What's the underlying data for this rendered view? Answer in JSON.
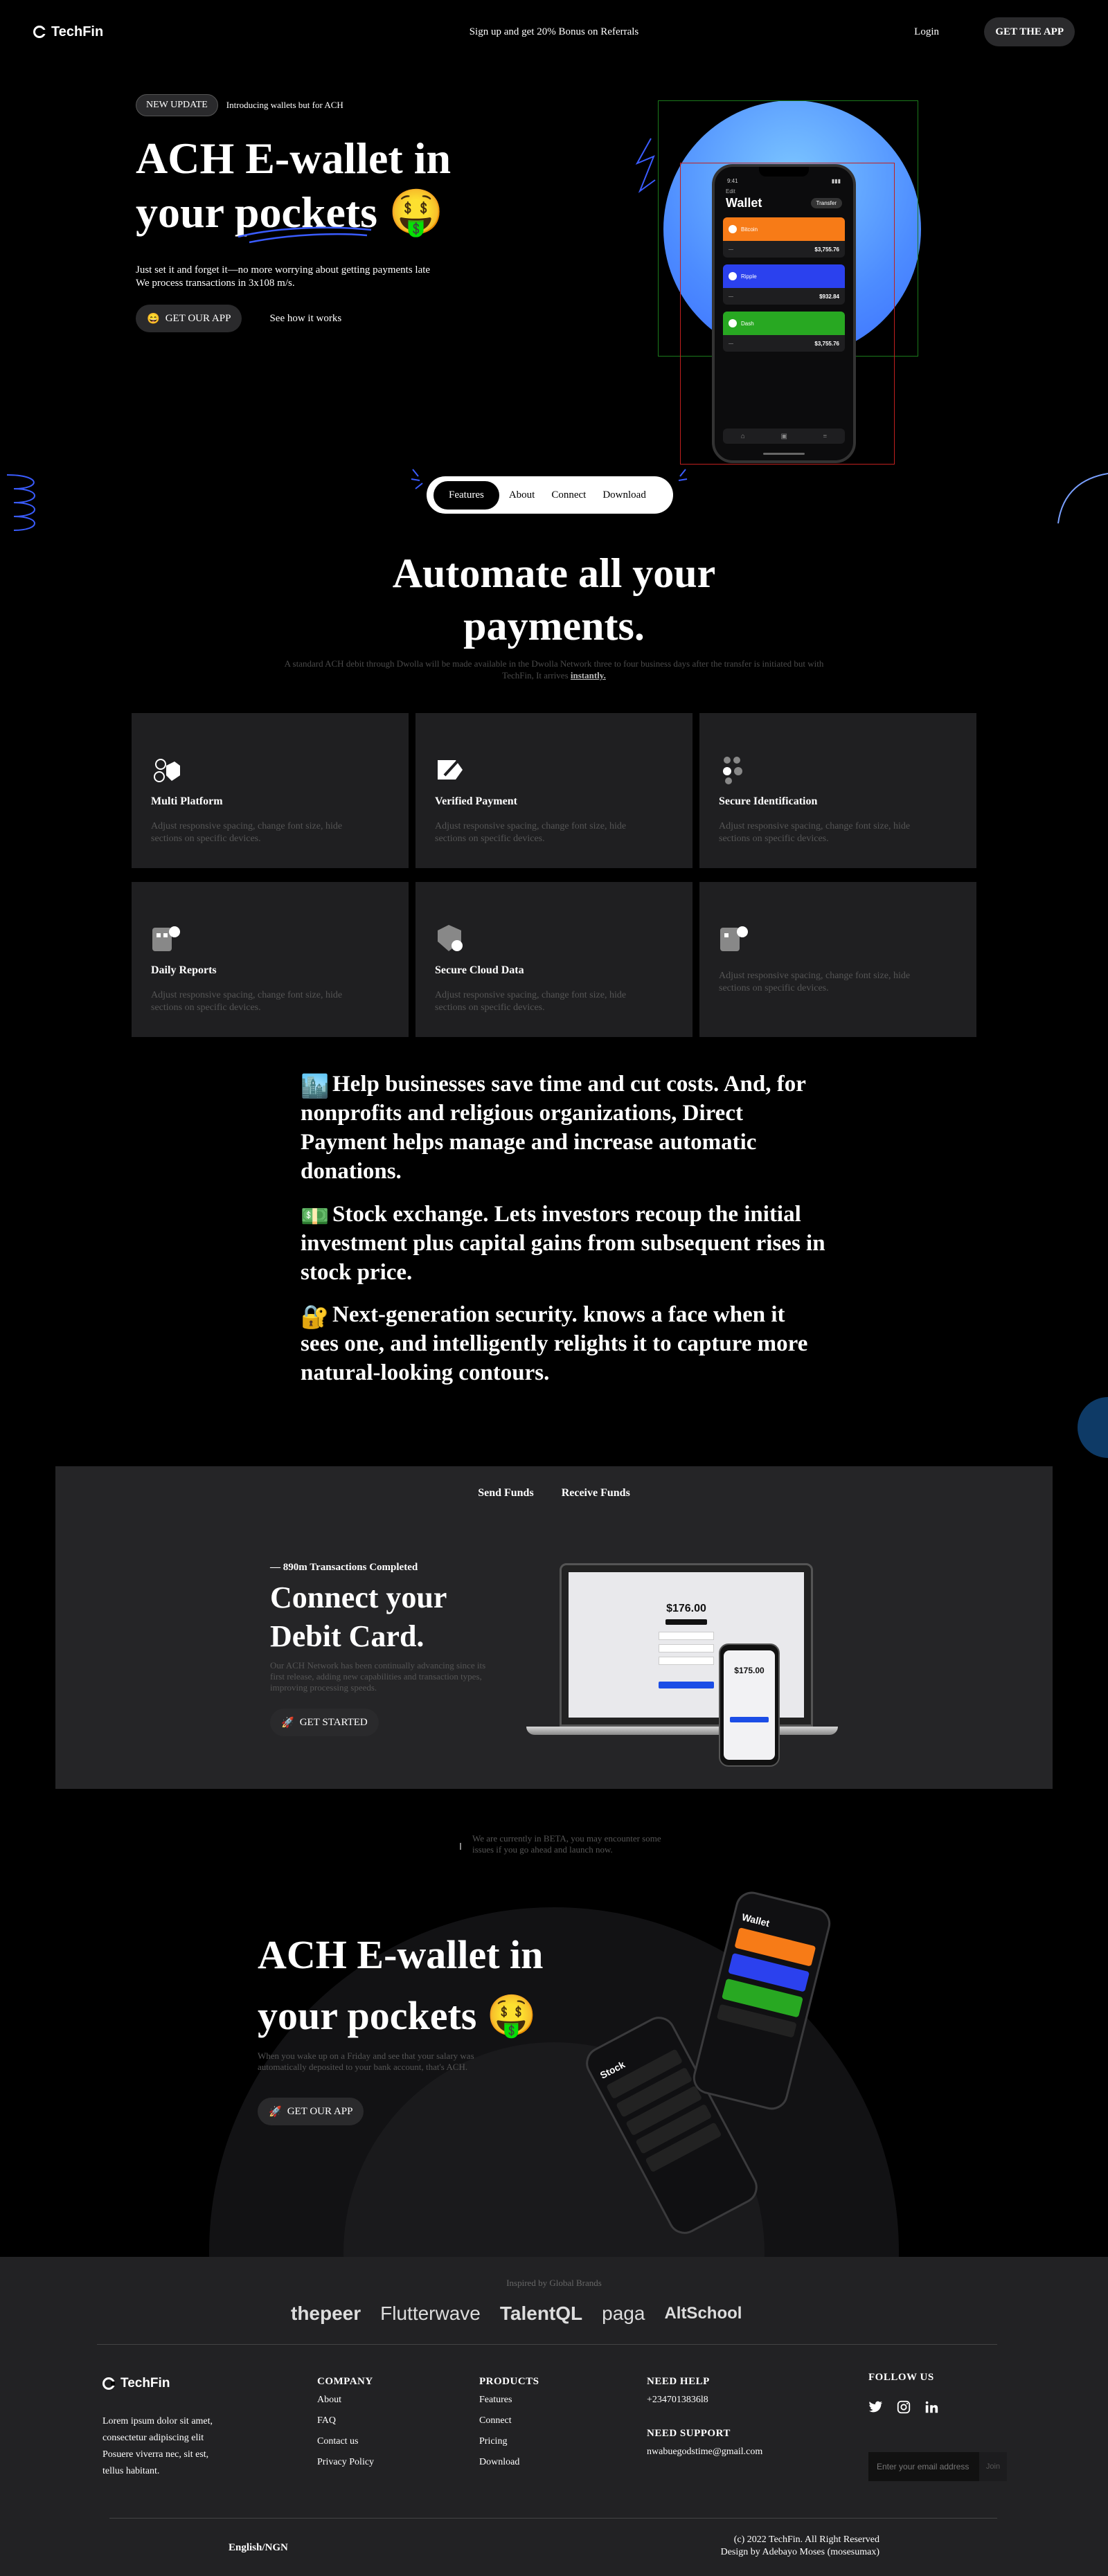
{
  "nav": {
    "brand": "TechFin",
    "promo": "Sign up and get 20% Bonus on Referrals",
    "login": "Login",
    "cta": "GET THE APP"
  },
  "hero": {
    "badge": "NEW UPDATE",
    "badge_text": "Introducing wallets but for ACH",
    "title_line1": "ACH E-wallet in",
    "title_line2": "your pockets",
    "title_emoji": "🤑",
    "subtitle_line1": "Just set it and forget it—no more worrying about getting payments late",
    "subtitle_line2": "We process transactions in 3x108 m/s.",
    "primary_cta": "GET OUR APP",
    "primary_cta_icon": "😄",
    "secondary_cta": "See how it works",
    "accent_blue": "#4d8cff"
  },
  "phone": {
    "time": "9:41",
    "back": "Edit",
    "title": "Wallet",
    "tag": "Transfer",
    "cards": [
      {
        "name": "Bitcoin",
        "value": "$3,755.76",
        "color": "#f77b17"
      },
      {
        "name": "Ripple",
        "value": "$932.84",
        "color": "#2b41ee"
      },
      {
        "name": "Dash",
        "value": "$3,755.76",
        "color": "#28a822"
      }
    ]
  },
  "tabs": {
    "items": [
      "Features",
      "About",
      "Connect",
      "Download"
    ],
    "active": "Features"
  },
  "automate": {
    "title_line1": "Automate all your",
    "title_line2": "payments.",
    "subtitle": "A standard ACH debit through Dwolla will be made available in the Dwolla Network three to four business days after the transfer is initiated but with TechFin, It arrives",
    "subtitle_emphasis": "instantly."
  },
  "features": [
    {
      "title": "Multi Platform",
      "desc": "Adjust responsive spacing, change font size, hide sections on specific devices.",
      "icon": "cube-icon"
    },
    {
      "title": "Verified Payment",
      "desc": "Adjust responsive spacing, change font size, hide sections on specific devices.",
      "icon": "verified-icon"
    },
    {
      "title": "Secure Identification",
      "desc": "Adjust responsive spacing, change font size, hide sections on specific devices.",
      "icon": "people-icon"
    },
    {
      "title": "Daily Reports",
      "desc": "Adjust responsive spacing, change font size, hide sections on specific devices.",
      "icon": "report-icon"
    },
    {
      "title": "Secure Cloud Data",
      "desc": "Adjust responsive spacing, change font size, hide sections on specific devices.",
      "icon": "cloud-shield-icon"
    },
    {
      "title": "",
      "desc": "Adjust responsive spacing, change font size, hide sections on specific devices.",
      "icon": "report-icon"
    }
  ],
  "statements": [
    {
      "emoji": "🏙️",
      "text": "Help businesses save time and cut costs. And, for nonprofits and religious organizations, Direct Payment helps manage and increase automatic donations."
    },
    {
      "emoji": "💵",
      "text": "Stock exchange. Lets investors recoup the initial investment plus capital gains from subsequent rises in stock price."
    },
    {
      "emoji": "🔐",
      "text": "Next-generation security. knows a face when it sees one, and intelligently relights it to capture more natural-looking contours."
    }
  ],
  "connect": {
    "tabs": [
      "Send Funds",
      "Receive Funds"
    ],
    "eyebrow": "— 890m Transactions Completed",
    "title_line1": "Connect your",
    "title_line2": "Debit Card.",
    "subtitle": "Our ACH Network has been continually advancing since its first release, adding new capabilities and transaction types, improving processing speeds.",
    "cta": "GET STARTED",
    "cta_icon": "🚀",
    "laptop_amount": "$176.00",
    "phone_amount": "$175.00"
  },
  "beta": {
    "text": "We are currently in BETA, you may encounter some issues if you go ahead and launch now."
  },
  "bottom_hero": {
    "title_line1": "ACH E-wallet in",
    "title_line2": "your pockets",
    "title_emoji": "🤑",
    "subtitle": "When you wake up on a Friday and see that your salary was automatically deposited to your bank account, that's ACH.",
    "cta": "GET OUR APP",
    "cta_icon": "🚀",
    "phone1_title": "Stock",
    "phone2_title": "Wallet"
  },
  "footer": {
    "inspired": "Inspired by Global Brands",
    "brands": [
      "thepeer",
      "Flutterwave",
      "TalentQL",
      "paga",
      "AltSchool"
    ],
    "brand_name": "TechFin",
    "about": "Lorem ipsum dolor sit amet, consectetur adipiscing elit Posuere viverra nec, sit est, tellus habitant.",
    "company": {
      "title": "COMPANY",
      "items": [
        "About",
        "FAQ",
        "Contact us",
        "Privacy Policy"
      ]
    },
    "products": {
      "title": "PRODUCTS",
      "items": [
        "Features",
        "Connect",
        "Pricing",
        "Download"
      ]
    },
    "help": {
      "title": "NEED HELP",
      "phone": "+2347013836l8"
    },
    "support": {
      "title": "NEED SUPPORT",
      "email": "nwabuegodstime@gmail.com"
    },
    "follow": {
      "title": "FOLLOW US",
      "icons": [
        "twitter-icon",
        "instagram-icon",
        "linkedin-icon"
      ]
    },
    "subscribe_placeholder": "Enter your email address",
    "subscribe_button": "Join",
    "language": "English/NGN",
    "copyright": "(c) 2022 TechFin. All Right Reserved",
    "credit": "Design by Adebayo Moses (mosesumax)"
  }
}
